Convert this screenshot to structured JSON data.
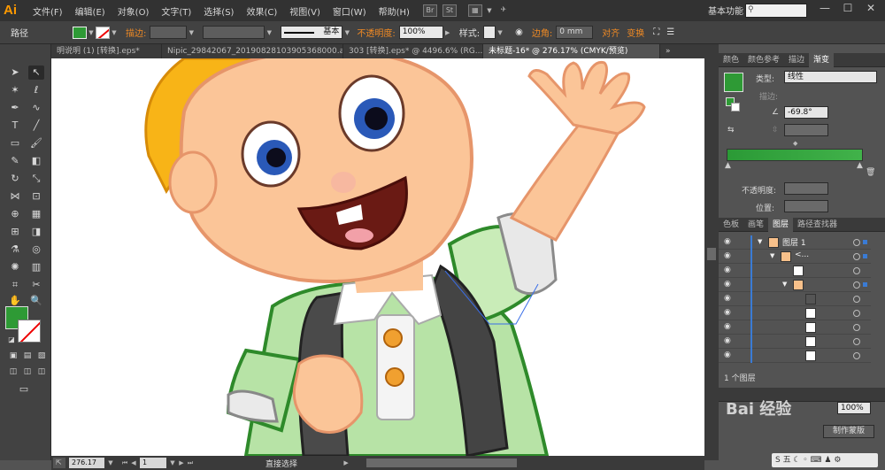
{
  "app": {
    "logo": "Ai",
    "workspace": "基本功能"
  },
  "menu": [
    "文件(F)",
    "编辑(E)",
    "对象(O)",
    "文字(T)",
    "选择(S)",
    "效果(C)",
    "视图(V)",
    "窗口(W)",
    "帮助(H)"
  ],
  "menu_extra": {
    "bridge": "Br",
    "stock": "St"
  },
  "control": {
    "object_type": "路径",
    "stroke_label": "描边:",
    "stroke_style": "基本",
    "opacity_label": "不透明度:",
    "opacity_value": "100%",
    "style_label": "样式:",
    "corner_label": "边角:",
    "corner_value": "0 mm",
    "align_label": "对齐",
    "transform_label": "变换"
  },
  "doc_tabs": [
    {
      "label": "明说明 (1) [转换].eps*",
      "active": false
    },
    {
      "label": "Nipic_29842067_20190828103905368000.ai*",
      "active": false
    },
    {
      "label": "303 [转换].eps* @ 4496.6% (RG...",
      "active": false
    },
    {
      "label": "未标题-16* @ 276.17% (CMYK/预览)",
      "active": true
    }
  ],
  "status": {
    "zoom": "276.17",
    "page": "1",
    "tool_text": "直接选择"
  },
  "panel_top": {
    "tabs": [
      {
        "label": "颜色",
        "active": false
      },
      {
        "label": "颜色参考",
        "active": false
      },
      {
        "label": "描边",
        "active": false
      },
      {
        "label": "渐变",
        "active": true
      }
    ],
    "type_label": "类型:",
    "type_value": "线性",
    "stroke_label": "描边:",
    "angle_value": "-69.8°",
    "opacity_label": "不透明度:",
    "position_label": "位置:",
    "gradient": {
      "start": "#2b9a36",
      "end": "#41b24a"
    }
  },
  "panel_layers": {
    "tabs": [
      {
        "label": "色板",
        "active": false
      },
      {
        "label": "画笔",
        "active": false
      },
      {
        "label": "图层",
        "active": true
      },
      {
        "label": "路径查找器",
        "active": false
      }
    ],
    "rows": [
      {
        "name": "图层 1",
        "indent": 0,
        "expanded": true
      },
      {
        "name": "<...",
        "indent": 1,
        "expanded": true
      },
      {
        "name": "",
        "indent": 2,
        "expanded": false
      },
      {
        "name": "",
        "indent": 2,
        "expanded": true
      },
      {
        "name": "",
        "indent": 3,
        "expanded": false
      },
      {
        "name": "",
        "indent": 3,
        "expanded": false
      },
      {
        "name": "",
        "indent": 3,
        "expanded": false
      },
      {
        "name": "",
        "indent": 3,
        "expanded": false
      },
      {
        "name": "",
        "indent": 3,
        "expanded": false
      }
    ],
    "footer": "1 个图层"
  },
  "panel_bottom": {
    "opacity_value": "100%",
    "make_mask": "制作蒙版",
    "watermark": "Bai 经验"
  },
  "colors": {
    "fill": "#2e9a35",
    "accent_orange": "#f08a24"
  }
}
